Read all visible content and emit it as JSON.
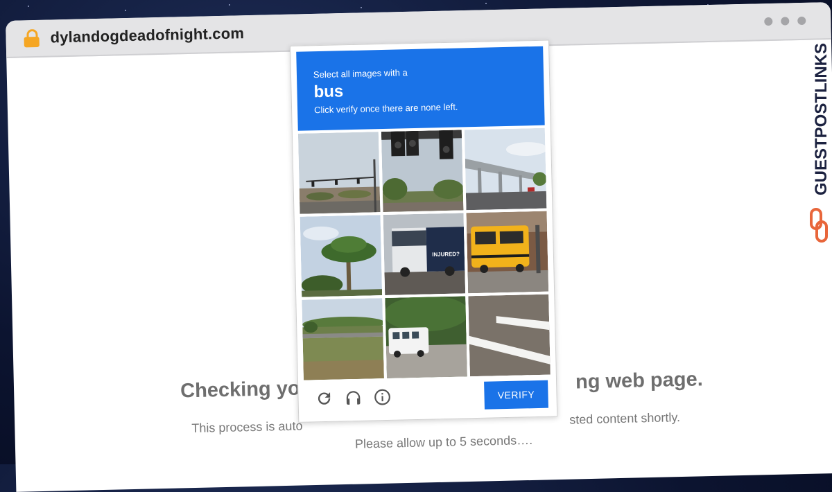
{
  "browser": {
    "url": "dylandogdeadofnight.com",
    "lock_color": "#f5a623"
  },
  "page": {
    "heading_left": "Checking you",
    "heading_right": "ng web page.",
    "sub_left": "This process is auto",
    "sub_right": "sted content shortly.",
    "wait": "Please allow up to 5 seconds…."
  },
  "captcha": {
    "instruction": "Select all images with a",
    "target": "bus",
    "hint": "Click verify once there are none left.",
    "verify_label": "VERIFY",
    "accent": "#1a73e8",
    "icons": [
      "reload-icon",
      "headphones-icon",
      "info-icon"
    ],
    "tiles": [
      {
        "subject": "traffic lights over road"
      },
      {
        "subject": "traffic lights close-up"
      },
      {
        "subject": "elevated highway"
      },
      {
        "subject": "palm tree"
      },
      {
        "subject": "city bus",
        "label": "INJURED?"
      },
      {
        "subject": "school bus"
      },
      {
        "subject": "grass field"
      },
      {
        "subject": "white shuttle bus"
      },
      {
        "subject": "road markings"
      }
    ]
  },
  "watermark": {
    "text": "GUESTPOSTLINKS",
    "accent": "#e8663b"
  }
}
